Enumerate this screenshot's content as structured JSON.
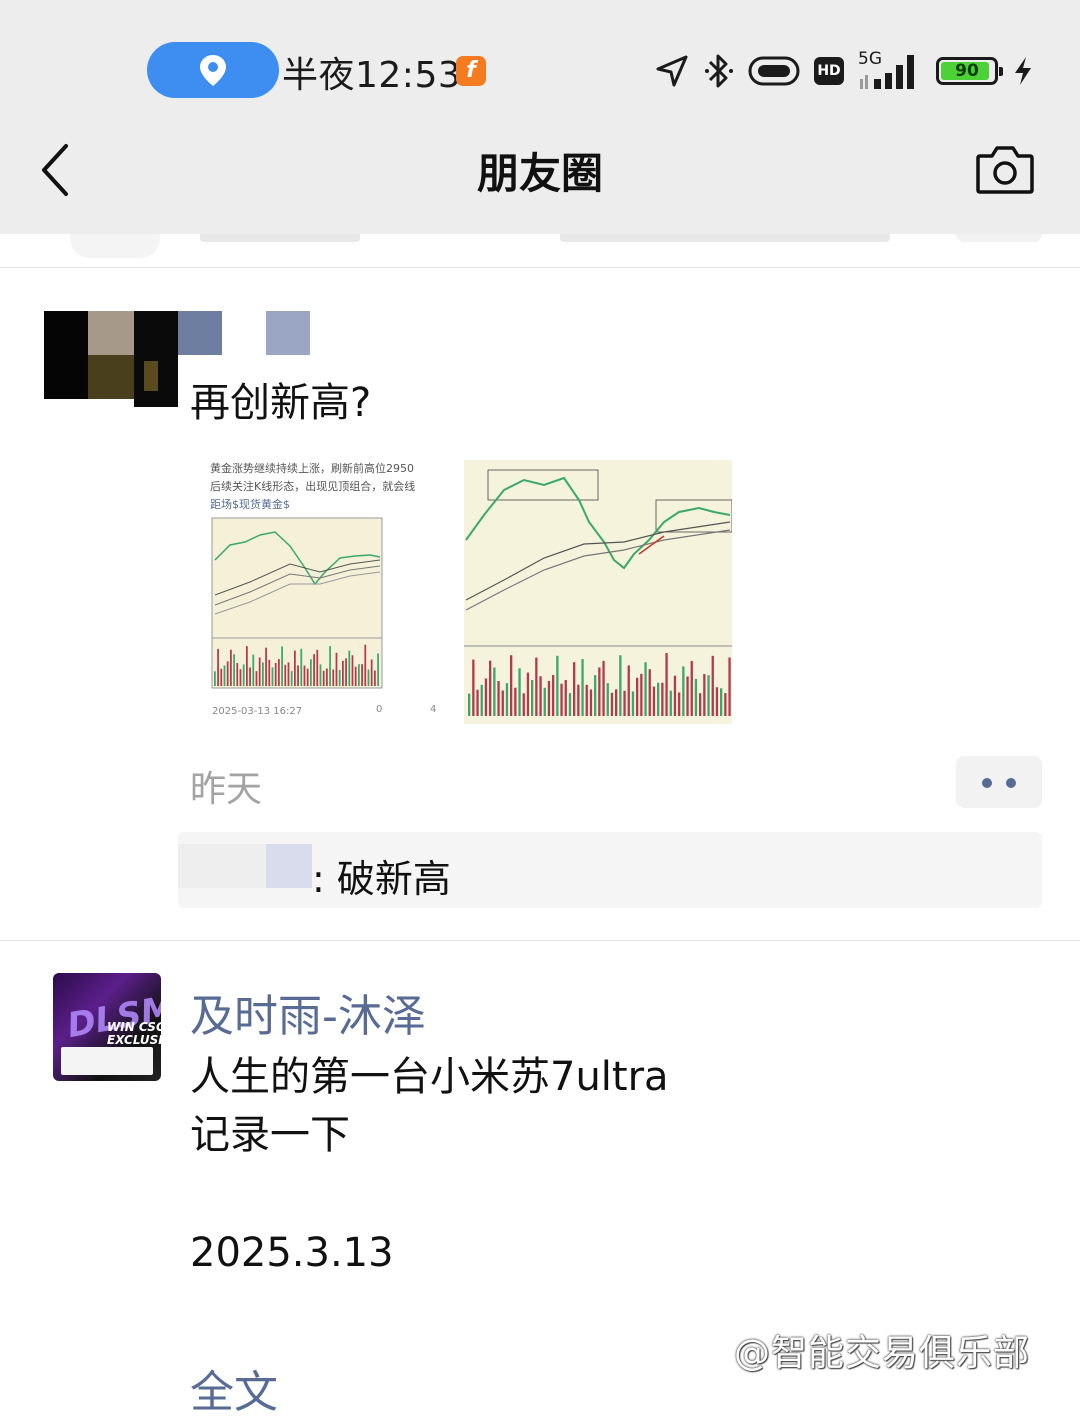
{
  "status_bar": {
    "time": "半夜12:53",
    "app_badge": "f",
    "network": "5G",
    "hd_label": "HD",
    "battery_level": 90,
    "battery_label": "90",
    "colors": {
      "location_pill": "#3d8ef0",
      "battery_fill": "#4cd137",
      "app_badge": "#f47b20"
    }
  },
  "nav": {
    "title": "朋友圈",
    "back_icon": "chevron-left-icon",
    "camera_icon": "camera-icon"
  },
  "posts": [
    {
      "text": "再创新高?",
      "images": [
        {
          "header_lines": [
            "黄金涨势继续持续上涨，刷新前高位2950",
            "后续关注K线形态，出现见顶组合，就会线",
            "距场$现货黄金$"
          ],
          "footer_date": "2025-03-13 16:27",
          "like_count": "0",
          "comment_count": "4"
        },
        {
          "description": "candlestick chart with volume"
        }
      ],
      "time": "昨天",
      "comment": {
        "text": ": 破新高"
      }
    },
    {
      "author": "及时雨-沐泽",
      "avatar_text": [
        "DLSM",
        "WIN CSGO",
        "EXCLUSIVE"
      ],
      "text_lines": [
        "人生的第一台小米苏7ultra",
        "记录一下",
        "",
        "2025.3.13"
      ],
      "full_text_link": "全文"
    }
  ],
  "watermark": "@智能交易俱乐部",
  "theme": {
    "link_color": "#576b95",
    "timestamp_color": "#a3a3a3",
    "topbar_bg": "#ededed"
  }
}
